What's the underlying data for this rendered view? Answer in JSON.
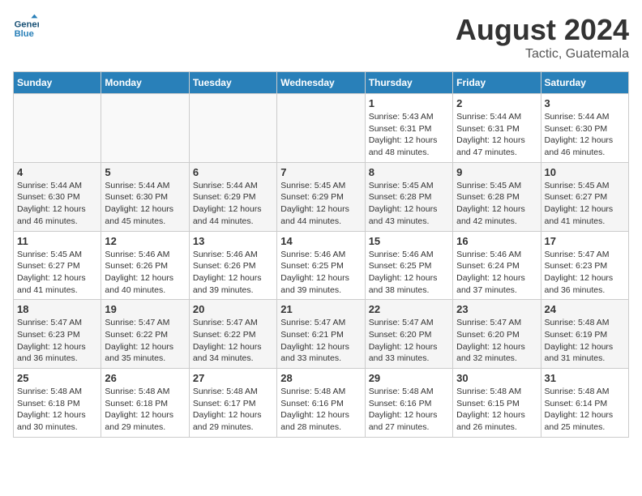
{
  "header": {
    "logo_line1": "General",
    "logo_line2": "Blue",
    "month_year": "August 2024",
    "location": "Tactic, Guatemala"
  },
  "weekdays": [
    "Sunday",
    "Monday",
    "Tuesday",
    "Wednesday",
    "Thursday",
    "Friday",
    "Saturday"
  ],
  "weeks": [
    [
      {
        "day": "",
        "info": ""
      },
      {
        "day": "",
        "info": ""
      },
      {
        "day": "",
        "info": ""
      },
      {
        "day": "",
        "info": ""
      },
      {
        "day": "1",
        "info": "Sunrise: 5:43 AM\nSunset: 6:31 PM\nDaylight: 12 hours\nand 48 minutes."
      },
      {
        "day": "2",
        "info": "Sunrise: 5:44 AM\nSunset: 6:31 PM\nDaylight: 12 hours\nand 47 minutes."
      },
      {
        "day": "3",
        "info": "Sunrise: 5:44 AM\nSunset: 6:30 PM\nDaylight: 12 hours\nand 46 minutes."
      }
    ],
    [
      {
        "day": "4",
        "info": "Sunrise: 5:44 AM\nSunset: 6:30 PM\nDaylight: 12 hours\nand 46 minutes."
      },
      {
        "day": "5",
        "info": "Sunrise: 5:44 AM\nSunset: 6:30 PM\nDaylight: 12 hours\nand 45 minutes."
      },
      {
        "day": "6",
        "info": "Sunrise: 5:44 AM\nSunset: 6:29 PM\nDaylight: 12 hours\nand 44 minutes."
      },
      {
        "day": "7",
        "info": "Sunrise: 5:45 AM\nSunset: 6:29 PM\nDaylight: 12 hours\nand 44 minutes."
      },
      {
        "day": "8",
        "info": "Sunrise: 5:45 AM\nSunset: 6:28 PM\nDaylight: 12 hours\nand 43 minutes."
      },
      {
        "day": "9",
        "info": "Sunrise: 5:45 AM\nSunset: 6:28 PM\nDaylight: 12 hours\nand 42 minutes."
      },
      {
        "day": "10",
        "info": "Sunrise: 5:45 AM\nSunset: 6:27 PM\nDaylight: 12 hours\nand 41 minutes."
      }
    ],
    [
      {
        "day": "11",
        "info": "Sunrise: 5:45 AM\nSunset: 6:27 PM\nDaylight: 12 hours\nand 41 minutes."
      },
      {
        "day": "12",
        "info": "Sunrise: 5:46 AM\nSunset: 6:26 PM\nDaylight: 12 hours\nand 40 minutes."
      },
      {
        "day": "13",
        "info": "Sunrise: 5:46 AM\nSunset: 6:26 PM\nDaylight: 12 hours\nand 39 minutes."
      },
      {
        "day": "14",
        "info": "Sunrise: 5:46 AM\nSunset: 6:25 PM\nDaylight: 12 hours\nand 39 minutes."
      },
      {
        "day": "15",
        "info": "Sunrise: 5:46 AM\nSunset: 6:25 PM\nDaylight: 12 hours\nand 38 minutes."
      },
      {
        "day": "16",
        "info": "Sunrise: 5:46 AM\nSunset: 6:24 PM\nDaylight: 12 hours\nand 37 minutes."
      },
      {
        "day": "17",
        "info": "Sunrise: 5:47 AM\nSunset: 6:23 PM\nDaylight: 12 hours\nand 36 minutes."
      }
    ],
    [
      {
        "day": "18",
        "info": "Sunrise: 5:47 AM\nSunset: 6:23 PM\nDaylight: 12 hours\nand 36 minutes."
      },
      {
        "day": "19",
        "info": "Sunrise: 5:47 AM\nSunset: 6:22 PM\nDaylight: 12 hours\nand 35 minutes."
      },
      {
        "day": "20",
        "info": "Sunrise: 5:47 AM\nSunset: 6:22 PM\nDaylight: 12 hours\nand 34 minutes."
      },
      {
        "day": "21",
        "info": "Sunrise: 5:47 AM\nSunset: 6:21 PM\nDaylight: 12 hours\nand 33 minutes."
      },
      {
        "day": "22",
        "info": "Sunrise: 5:47 AM\nSunset: 6:20 PM\nDaylight: 12 hours\nand 33 minutes."
      },
      {
        "day": "23",
        "info": "Sunrise: 5:47 AM\nSunset: 6:20 PM\nDaylight: 12 hours\nand 32 minutes."
      },
      {
        "day": "24",
        "info": "Sunrise: 5:48 AM\nSunset: 6:19 PM\nDaylight: 12 hours\nand 31 minutes."
      }
    ],
    [
      {
        "day": "25",
        "info": "Sunrise: 5:48 AM\nSunset: 6:18 PM\nDaylight: 12 hours\nand 30 minutes."
      },
      {
        "day": "26",
        "info": "Sunrise: 5:48 AM\nSunset: 6:18 PM\nDaylight: 12 hours\nand 29 minutes."
      },
      {
        "day": "27",
        "info": "Sunrise: 5:48 AM\nSunset: 6:17 PM\nDaylight: 12 hours\nand 29 minutes."
      },
      {
        "day": "28",
        "info": "Sunrise: 5:48 AM\nSunset: 6:16 PM\nDaylight: 12 hours\nand 28 minutes."
      },
      {
        "day": "29",
        "info": "Sunrise: 5:48 AM\nSunset: 6:16 PM\nDaylight: 12 hours\nand 27 minutes."
      },
      {
        "day": "30",
        "info": "Sunrise: 5:48 AM\nSunset: 6:15 PM\nDaylight: 12 hours\nand 26 minutes."
      },
      {
        "day": "31",
        "info": "Sunrise: 5:48 AM\nSunset: 6:14 PM\nDaylight: 12 hours\nand 25 minutes."
      }
    ]
  ]
}
